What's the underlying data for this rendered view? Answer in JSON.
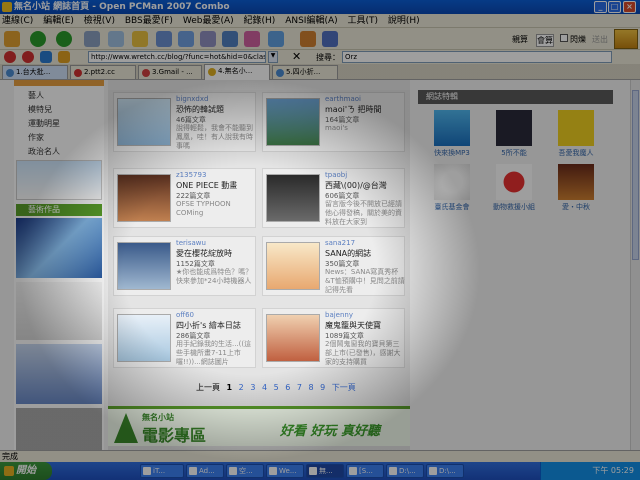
{
  "window": {
    "title": "無名小站 網誌首頁 - Open PCMan 2007 Combo"
  },
  "menu": [
    "連線(C)",
    "編輯(E)",
    "檢視(V)",
    "BBS最愛(F)",
    "Web最愛(A)",
    "紀錄(H)",
    "ANSI編輯(A)",
    "工具(T)",
    "說明(H)"
  ],
  "toolbar": {
    "right_labels": [
      "親算",
      "會算",
      "閃爍",
      "送出"
    ]
  },
  "address": {
    "value": "http://www.wretch.cc/blog/?func=hot&hid=0&class_id=0&q",
    "search_label": "搜尋：",
    "search_value": "Orz"
  },
  "tabs": [
    {
      "label": "1.台大批...",
      "color": "#4a8ad0"
    },
    {
      "label": "2.ptt2.cc",
      "color": "#d03030"
    },
    {
      "label": "3.Gmail - ...",
      "color": "#d04040"
    },
    {
      "label": "4.無名小...",
      "color": "#e0b020"
    },
    {
      "label": "5.四小折...",
      "color": "#4a8ad0"
    }
  ],
  "categories": [
    "藝人",
    "模特兒",
    "運動明星",
    "作家",
    "政治名人"
  ],
  "section_label": "藝術作品",
  "blogs": [
    {
      "user": "bignxdxd",
      "title": "恐怖的韓試題",
      "count": "46篇文章",
      "desc": "說得輕鬆，我會不能聽到鳳凰，哇！有人說我有時事嗎"
    },
    {
      "user": "earthmaoi",
      "title": "maoi'ㄋ 把時間",
      "count": "164篇文章",
      "desc": "maoi's"
    },
    {
      "user": "z135793",
      "title": "ONE PIECE 動畫",
      "count": "222篇文章",
      "desc": "OFSE TYPHOON COMing"
    },
    {
      "user": "tpaobj",
      "title": "西藏\\(00)/@台灣",
      "count": "606篇文章",
      "desc": "留言版今後不開放已經請他心得發稿，關於美的資料放在大家到"
    },
    {
      "user": "terisawu",
      "title": "愛在櫻花綻放時",
      "count": "1152篇文章",
      "desc": "★你也能成爲特色？嗎？快來參加*24小時機器人"
    },
    {
      "user": "sana217",
      "title": "SANA的網誌",
      "count": "350篇文章",
      "desc": "News：SANA寫真秀杯&T恤預購中！見問之前請記得先看"
    },
    {
      "user": "off60",
      "title": "四小折's 繪本日誌",
      "count": "286篇文章",
      "desc": "用手紀錄我的生活...((這些手機所畫7-11上市囉!!))...網誌圖片"
    },
    {
      "user": "bajenny",
      "title": "魔鬼籠與天使寶",
      "count": "1089篇文章",
      "desc": "2個鬧鬼窗我的寶貝第三部上市(已發售)，感謝大家的支持購買"
    }
  ],
  "pager": {
    "prev": "上一頁",
    "pages": [
      "1",
      "2",
      "3",
      "4",
      "5",
      "6",
      "7",
      "8",
      "9"
    ],
    "current": "1",
    "next": "下一頁"
  },
  "banner": {
    "title": "電影專區",
    "subtitle": "無名小站",
    "slogan": "好看 好玩 真好聽"
  },
  "links_panel": {
    "title": "網誌特輯",
    "items": [
      "快來換MP3",
      "5所不能",
      "吾愛我魔人",
      "臺氏基金會",
      "動物救援小組",
      "愛・中秋"
    ]
  },
  "status": {
    "text": "完成"
  },
  "taskbar": {
    "start": "開始",
    "tasks": [
      "iT...",
      "Ad...",
      "空...",
      "We...",
      "無...",
      "[S...",
      "D:\\...",
      "D:\\..."
    ],
    "clock": "下午 05:29"
  }
}
